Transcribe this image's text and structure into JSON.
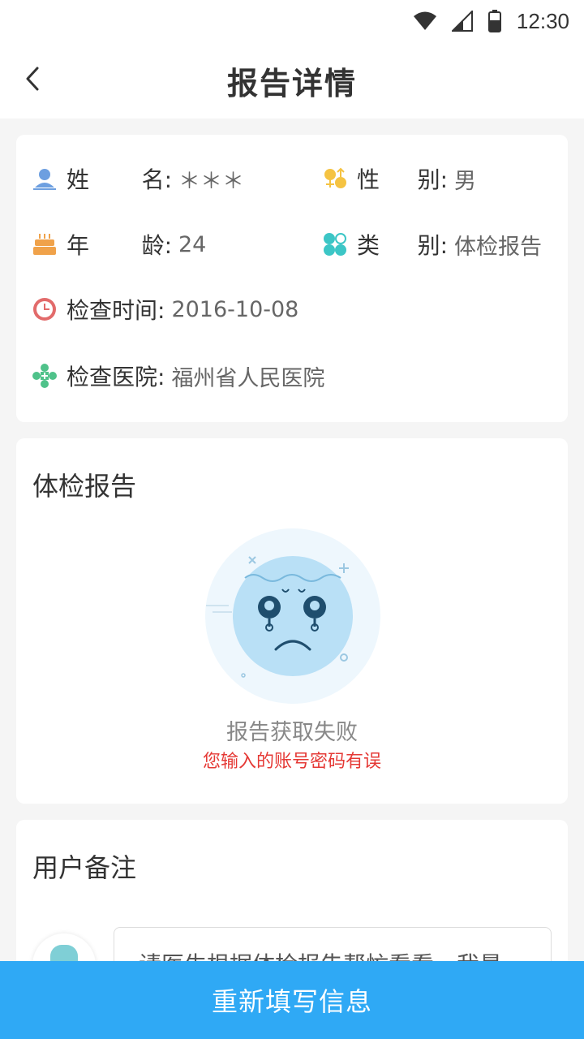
{
  "status_bar": {
    "time": "12:30",
    "icons": [
      "wifi-icon",
      "signal-icon",
      "battery-icon"
    ]
  },
  "nav": {
    "title": "报告详情",
    "back_icon": "chevron-left-icon"
  },
  "info": {
    "name": {
      "label_a": "姓",
      "label_b": "名:",
      "value": "＊＊＊",
      "icon": "person-icon",
      "color": "#6d9fe0"
    },
    "gender": {
      "label_a": "性",
      "label_b": "别:",
      "value": "男",
      "icon": "gender-icon",
      "color": "#f5c342"
    },
    "age": {
      "label_a": "年",
      "label_b": "龄:",
      "value": "24",
      "icon": "cake-icon",
      "color": "#f0a24a"
    },
    "category": {
      "label_a": "类",
      "label_b": "别:",
      "value": "体检报告",
      "icon": "grid-icon",
      "color": "#3cc6c6"
    },
    "exam_time": {
      "label": "检查时间:",
      "value": "2016-10-08",
      "icon": "clock-icon",
      "color": "#e26b6b"
    },
    "hospital": {
      "label": "检查医院:",
      "value": "福州省人民医院",
      "icon": "hospital-cross-icon",
      "color": "#4fc28a"
    }
  },
  "report": {
    "title": "体检报告",
    "illustration_icon": "crying-face-icon",
    "error_title": "报告获取失败",
    "error_subtitle": "您输入的账号密码有误",
    "error_color": "#e53935"
  },
  "notes": {
    "title": "用户备注",
    "avatar_icon": "avatar-icon",
    "message": "请医生根据体检报告帮忙看看，我最"
  },
  "bottom_button": {
    "label": "重新填写信息",
    "color": "#2fa9f5"
  }
}
